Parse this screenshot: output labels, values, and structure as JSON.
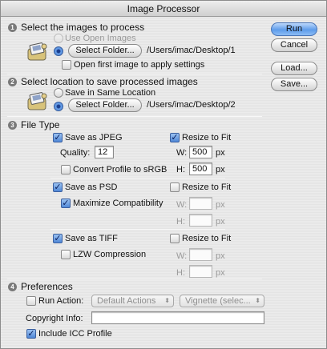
{
  "window": {
    "title": "Image Processor"
  },
  "section1": {
    "num": "1",
    "heading": "Select the images to process",
    "use_open": "Use Open Images",
    "select_folder": "Select Folder...",
    "path": "/Users/imac/Desktop/1",
    "open_first": "Open first image to apply settings"
  },
  "section2": {
    "num": "2",
    "heading": "Select location to save processed images",
    "same_location": "Save in Same Location",
    "select_folder": "Select Folder...",
    "path": "/Users/imac/Desktop/2"
  },
  "section3": {
    "num": "3",
    "heading": "File Type",
    "jpeg": {
      "save_label": "Save as JPEG",
      "resize_label": "Resize to Fit",
      "quality_label": "Quality:",
      "quality_value": "12",
      "w_label": "W:",
      "w_value": "500",
      "w_unit": "px",
      "h_label": "H:",
      "h_value": "500",
      "h_unit": "px",
      "convert_label": "Convert Profile to sRGB"
    },
    "psd": {
      "save_label": "Save as PSD",
      "resize_label": "Resize to Fit",
      "maximize_label": "Maximize Compatibility",
      "w_label": "W:",
      "w_unit": "px",
      "h_label": "H:",
      "h_unit": "px"
    },
    "tiff": {
      "save_label": "Save as TIFF",
      "resize_label": "Resize to Fit",
      "lzw_label": "LZW Compression",
      "w_label": "W:",
      "w_unit": "px",
      "h_label": "H:",
      "h_unit": "px"
    }
  },
  "section4": {
    "num": "4",
    "heading": "Preferences",
    "run_action": "Run Action:",
    "action_set": "Default Actions",
    "action": "Vignette (selec...",
    "copyright_label": "Copyright Info:",
    "copyright_value": "",
    "icc_label": "Include ICC Profile"
  },
  "buttons": {
    "run": "Run",
    "cancel": "Cancel",
    "load": "Load...",
    "save": "Save..."
  },
  "glyphs": {
    "check": "✓",
    "arrows": "⬍"
  },
  "colors": {
    "accent": "#5e9cea",
    "divider": "#9e9e9e"
  }
}
